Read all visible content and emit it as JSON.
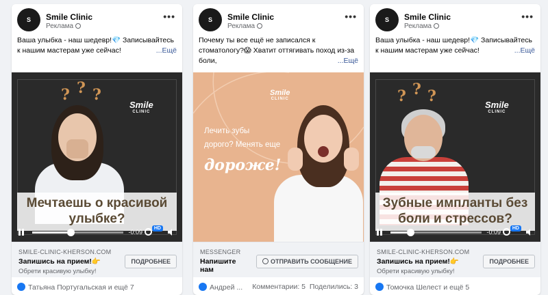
{
  "ads": [
    {
      "page_name": "Smile Clinic",
      "sponsored": "Реклама",
      "text": "Ваша улыбка - наш шедевр!💎 Записывайтесь к нашим мастерам уже сейчас!",
      "see_more": "...Ещё",
      "creative": {
        "brand": "Smile",
        "brand_sub": "CLINIC",
        "caption": "Мечтаешь о красивой улыбке?",
        "time": "-0:09",
        "hd": "HD"
      },
      "domain": "SMILE-CLINIC-KHERSON.COM",
      "cta_title": "Запишись на прием!👉",
      "cta_subtitle": "Обрети красивую улыбку!",
      "cta_button": "ПОДРОБНЕЕ",
      "reactions": "Татьяна Португальская и ещё 7"
    },
    {
      "page_name": "Smile Clinic",
      "sponsored": "Реклама",
      "text": "Почему ты все ещё не записался к стоматологу?😱 Хватит оттягивать поход из-за боли,",
      "see_more": "...Ещё",
      "creative": {
        "brand": "Smile",
        "brand_sub": "CLINIC",
        "line1": "Лечить зубы",
        "line2": "дорого? Менять еще",
        "line3": "дороже!"
      },
      "domain": "MESSENGER",
      "cta_title": "Напишите нам",
      "cta_button": "ОТПРАВИТЬ СООБЩЕНИЕ",
      "reactions": "Андрей ...",
      "comments": "Комментарии: 5",
      "shares": "Поделились: 3"
    },
    {
      "page_name": "Smile Clinic",
      "sponsored": "Реклама",
      "text": "Ваша улыбка - наш шедевр!💎 Записывайтесь к нашим мастерам уже сейчас!",
      "see_more": "...Ещё",
      "creative": {
        "brand": "Smile",
        "brand_sub": "CLINIC",
        "caption": "Зубные импланты без боли и стрессов?",
        "time": "-0:09",
        "hd": "HD"
      },
      "domain": "SMILE-CLINIC-KHERSON.COM",
      "cta_title": "Запишись на прием!👉",
      "cta_subtitle": "Обрети красивую улыбку!",
      "cta_button": "ПОДРОБНЕЕ",
      "reactions": "Томочка Шелест и ещё 5"
    }
  ],
  "colors": {
    "accent": "#1877f2",
    "peach_bg": "#e8b48f",
    "gold": "#d19656",
    "caption_text": "#5a4a34"
  }
}
